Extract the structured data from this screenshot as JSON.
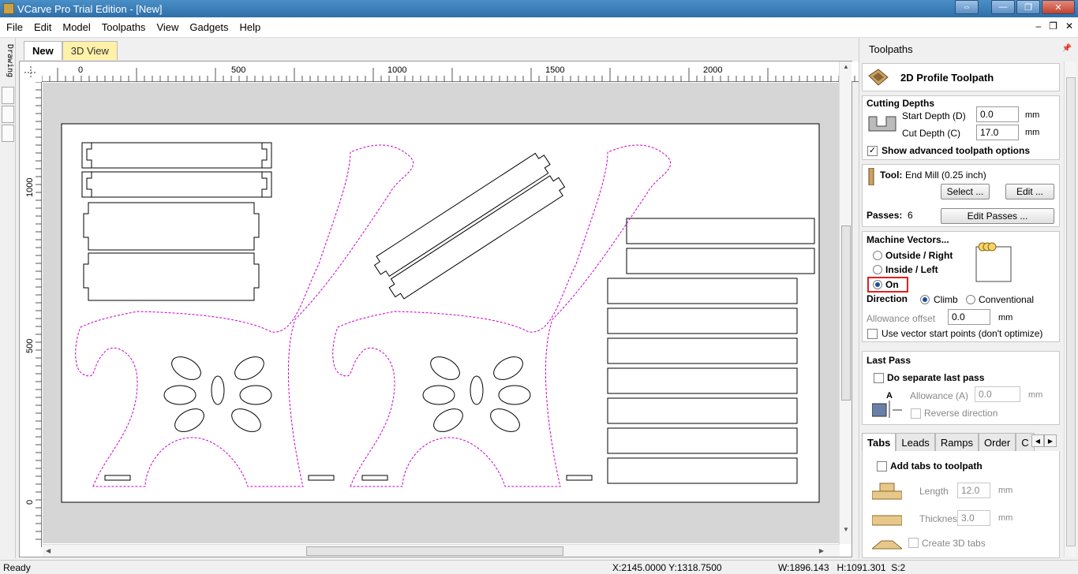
{
  "window": {
    "title": "VCarve Pro Trial Edition - [New]",
    "buttons": [
      "⇔",
      "—",
      "❐",
      "✕"
    ]
  },
  "menu": {
    "items": [
      "File",
      "Edit",
      "Model",
      "Toolpaths",
      "View",
      "Gadgets",
      "Help"
    ],
    "mdi_buttons": [
      "–",
      "❐",
      "✕"
    ]
  },
  "left_strip": {
    "label": "Drawing"
  },
  "doc_tabs": {
    "tabs": [
      "New",
      "3D View"
    ],
    "active": "New"
  },
  "rulers": {
    "horizontal_ticks": [
      "0",
      "500",
      "1000",
      "1500",
      "2000"
    ],
    "vertical_ticks": [
      "1000",
      "500",
      "0"
    ]
  },
  "panel": {
    "title": "Toolpaths",
    "header": "2D Profile Toolpath",
    "cutting_depths": {
      "heading": "Cutting Depths",
      "start_depth_label": "Start Depth (D)",
      "start_depth_value": "0.0",
      "cut_depth_label": "Cut Depth (C)",
      "cut_depth_value": "17.0",
      "unit": "mm",
      "show_advanced_label": "Show advanced toolpath options",
      "show_advanced_checked": true
    },
    "tool": {
      "label": "Tool:",
      "name": "End Mill (0.25 inch)",
      "select_button": "Select ...",
      "edit_button": "Edit ...",
      "passes_label": "Passes:",
      "passes_value": "6",
      "edit_passes_button": "Edit Passes ..."
    },
    "machine_vectors": {
      "heading": "Machine Vectors...",
      "options": [
        "Outside / Right",
        "Inside / Left",
        "On"
      ],
      "selected": "On",
      "direction_label": "Direction",
      "direction_options": [
        "Climb",
        "Conventional"
      ],
      "direction_selected": "Climb",
      "allowance_label": "Allowance offset",
      "allowance_value": "0.0",
      "unit": "mm",
      "vector_start_label": "Use vector start points (don't optimize)"
    },
    "last_pass": {
      "heading": "Last Pass",
      "separate_label": "Do separate last pass",
      "allowance_label": "Allowance (A)",
      "allowance_value": "0.0",
      "unit": "mm",
      "reverse_label": "Reverse direction",
      "diagram_letter": "A"
    },
    "tabs": {
      "items": [
        "Tabs",
        "Leads",
        "Ramps",
        "Order",
        "C"
      ],
      "active": "Tabs",
      "add_tabs_label": "Add tabs to toolpath",
      "length_label": "Length",
      "length_value": "12.0",
      "thickness_label": "Thickness",
      "thickness_value": "3.0",
      "unit": "mm",
      "create_3d_label": "Create 3D tabs"
    }
  },
  "status": {
    "ready": "Ready",
    "coords": "X:2145.0000 Y:1318.7500",
    "size": "W:1896.143   H:1091.301  S:2"
  },
  "colors": {
    "selection_dash": "#cc00cc",
    "highlight_box": "#e02020",
    "tab_inactive": "#fff1a8",
    "titlebar": "#2f6fa8"
  }
}
